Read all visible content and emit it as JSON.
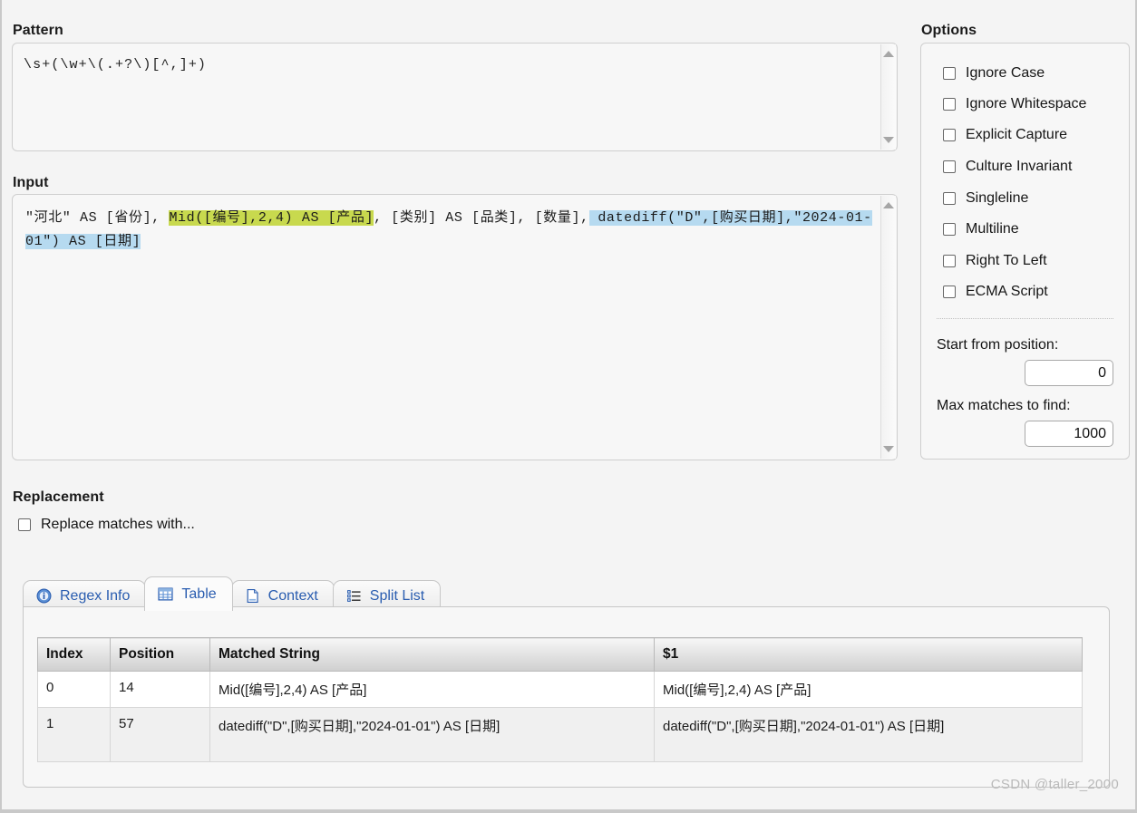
{
  "pattern": {
    "label": "Pattern",
    "value": "\\s+(\\w+\\(.+?\\)[^,]+)"
  },
  "input": {
    "label": "Input",
    "segments": [
      {
        "text": "\"河北\" AS [省份],",
        "highlight": "none"
      },
      {
        "text": " ",
        "highlight": "none"
      },
      {
        "text": "Mid([编号],2,4) AS [产品]",
        "highlight": "green"
      },
      {
        "text": ", [类别] AS [品类], [数量],",
        "highlight": "none"
      },
      {
        "text": " ",
        "highlight": "blue"
      },
      {
        "text": "datediff(\"D\",[购买日期],\"2024-01-01\") AS [日期]",
        "highlight": "blue"
      }
    ],
    "full_text": "\"河北\" AS [省份], Mid([编号],2,4) AS [产品], [类别] AS [品类], [数量], datediff(\"D\",[购买日期],\"2024-01-01\") AS [日期]"
  },
  "options": {
    "label": "Options",
    "checkboxes": [
      {
        "label": "Ignore Case",
        "checked": false
      },
      {
        "label": "Ignore Whitespace",
        "checked": false
      },
      {
        "label": "Explicit Capture",
        "checked": false
      },
      {
        "label": "Culture Invariant",
        "checked": false
      },
      {
        "label": "Singleline",
        "checked": false
      },
      {
        "label": "Multiline",
        "checked": false
      },
      {
        "label": "Right To Left",
        "checked": false
      },
      {
        "label": "ECMA Script",
        "checked": false
      }
    ],
    "start_position": {
      "label": "Start from position:",
      "value": "0"
    },
    "max_matches": {
      "label": "Max matches to find:",
      "value": "1000"
    }
  },
  "replacement": {
    "label": "Replacement",
    "checkbox_label": "Replace matches with...",
    "checked": false
  },
  "tabs": [
    {
      "label": "Regex Info",
      "icon": "info-icon",
      "active": false
    },
    {
      "label": "Table",
      "icon": "table-grid-icon",
      "active": true
    },
    {
      "label": "Context",
      "icon": "document-icon",
      "active": false
    },
    {
      "label": "Split List",
      "icon": "list-icon",
      "active": false
    }
  ],
  "results_table": {
    "headers": [
      "Index",
      "Position",
      "Matched String",
      "$1"
    ],
    "rows": [
      {
        "index": "0",
        "position": "14",
        "matched": "Mid([编号],2,4) AS [产品]",
        "group1": "Mid([编号],2,4) AS [产品]"
      },
      {
        "index": "1",
        "position": "57",
        "matched": "datediff(\"D\",[购买日期],\"2024-01-01\") AS [日期]",
        "group1": "datediff(\"D\",[购买日期],\"2024-01-01\") AS [日期]"
      }
    ]
  },
  "watermark": "CSDN @taller_2000",
  "colors": {
    "highlight_primary": "#c8d94e",
    "highlight_secondary": "#b6daf0",
    "tab_text": "#2a5db0",
    "panel_bg": "#f7f7f7"
  }
}
